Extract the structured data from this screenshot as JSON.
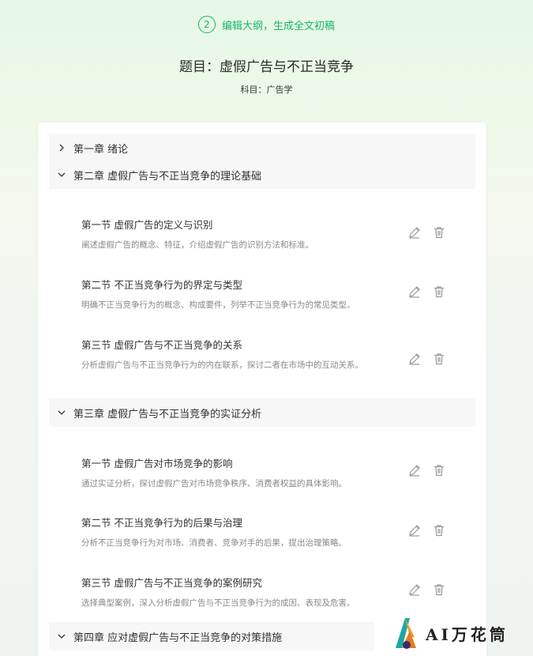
{
  "step": {
    "number": "2",
    "label": "编辑大纲，生成全文初稿"
  },
  "title": "题目：虚假广告与不正当竞争",
  "subject": "科目：广告学",
  "chapters": [
    {
      "label": "第一章 绪论",
      "expanded": false,
      "sections": []
    },
    {
      "label": "第二章 虚假广告与不正当竞争的理论基础",
      "expanded": true,
      "sections": [
        {
          "title": "第一节 虚假广告的定义与识别",
          "desc": "阐述虚假广告的概念、特征，介绍虚假广告的识别方法和标准。"
        },
        {
          "title": "第二节 不正当竞争行为的界定与类型",
          "desc": "明确不正当竞争行为的概念、构成要件，列举不正当竞争行为的常见类型。"
        },
        {
          "title": "第三节 虚假广告与不正当竞争的关系",
          "desc": "分析虚假广告与不正当竞争行为的内在联系，探讨二者在市场中的互动关系。"
        }
      ]
    },
    {
      "label": "第三章 虚假广告与不正当竞争的实证分析",
      "expanded": true,
      "sections": [
        {
          "title": "第一节 虚假广告对市场竞争的影响",
          "desc": "通过实证分析，探讨虚假广告对市场竞争秩序、消费者权益的具体影响。"
        },
        {
          "title": "第二节 不正当竞争行为的后果与治理",
          "desc": "分析不正当竞争行为对市场、消费者、竞争对手的后果，提出治理策略。"
        },
        {
          "title": "第三节 虚假广告与不正当竞争的案例研究",
          "desc": "选择典型案例，深入分析虚假广告与不正当竞争行为的成因、表现及危害。"
        }
      ]
    },
    {
      "label": "第四章 应对虚假广告与不正当竞争的对策措施",
      "expanded": true,
      "sections": []
    }
  ],
  "logo": {
    "text": "AI万花筒"
  },
  "colors": {
    "accent": "#19b36b",
    "chapter_bg": "#f7f7f7"
  },
  "icons": {
    "edit": "pencil-icon",
    "delete": "trash-icon",
    "collapsed": "chevron-right-icon",
    "expanded": "chevron-down-icon"
  }
}
